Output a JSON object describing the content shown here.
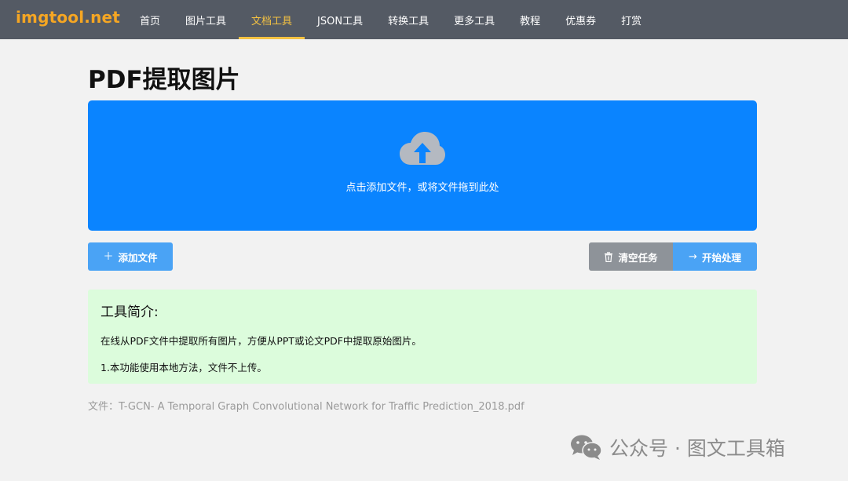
{
  "brand": {
    "logo": "imgtool.net"
  },
  "nav": {
    "items": [
      {
        "label": "首页"
      },
      {
        "label": "图片工具"
      },
      {
        "label": "文档工具"
      },
      {
        "label": "JSON工具"
      },
      {
        "label": "转换工具"
      },
      {
        "label": "更多工具"
      },
      {
        "label": "教程"
      },
      {
        "label": "优惠券"
      },
      {
        "label": "打赏"
      }
    ],
    "active_index": 2
  },
  "page": {
    "title": "PDF提取图片"
  },
  "dropzone": {
    "hint": "点击添加文件，或将文件拖到此处",
    "icon": "cloud-upload-icon"
  },
  "actions": {
    "add_label": "添加文件",
    "add_icon": "plus-icon",
    "clear_label": "清空任务",
    "clear_icon": "trash-icon",
    "start_label": "开始处理",
    "start_icon": "arrow-right-icon"
  },
  "intro": {
    "title": "工具简介:",
    "lines": [
      "在线从PDF文件中提取所有图片，方便从PPT或论文PDF中提取原始图片。",
      "1.本功能使用本地方法，文件不上传。"
    ]
  },
  "file": {
    "label": "文件：",
    "name": "T-GCN- A Temporal Graph Convolutional Network for Traffic Prediction_2018.pdf"
  },
  "watermark": {
    "text": "公众号 · 图文工具箱",
    "icon": "wechat-icon"
  },
  "colors": {
    "topbar": "#545a64",
    "logo": "#f5a623",
    "nav_active": "#f5c242",
    "dropzone": "#0a84ff",
    "primary_button": "#4aa3f5",
    "secondary_button": "#8e9399",
    "intro_bg": "#dcfcdc"
  }
}
